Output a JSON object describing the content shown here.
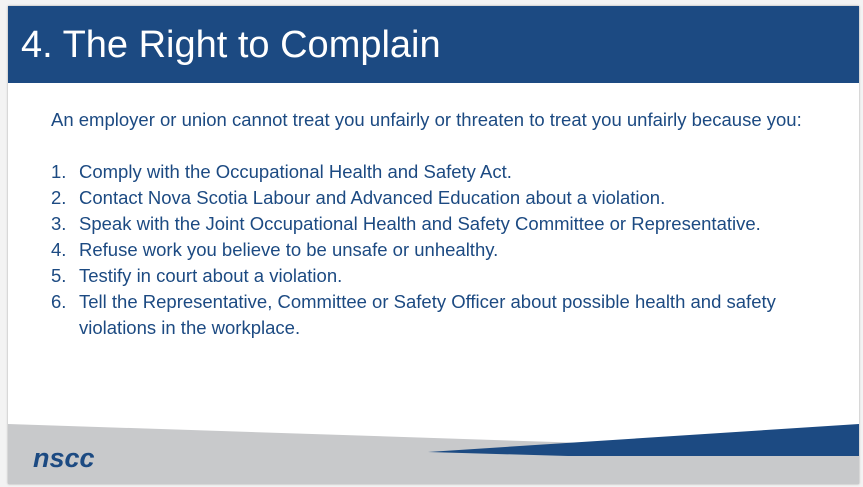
{
  "slide": {
    "title": "4. The Right to Complain",
    "intro": "An employer or union cannot treat you unfairly or threaten to treat you unfairly because you:",
    "items": [
      {
        "num": "1.",
        "text": "Comply with the Occupational Health and Safety Act."
      },
      {
        "num": "2.",
        "text": "Contact Nova Scotia Labour and Advanced Education about a violation."
      },
      {
        "num": "3.",
        "text": "Speak with the Joint Occupational Health and Safety Committee or Representative."
      },
      {
        "num": "4.",
        "text": "Refuse work you believe to be unsafe or unhealthy."
      },
      {
        "num": "5.",
        "text": "Testify in court about a violation."
      },
      {
        "num": "6.",
        "text": "Tell the Representative, Committee or Safety Officer about possible health and safety violations in the workplace."
      }
    ],
    "logo": "nscc"
  },
  "colors": {
    "brand_blue": "#1c4a82",
    "footer_gray": "#c8c9cb",
    "background": "#ffffff"
  }
}
